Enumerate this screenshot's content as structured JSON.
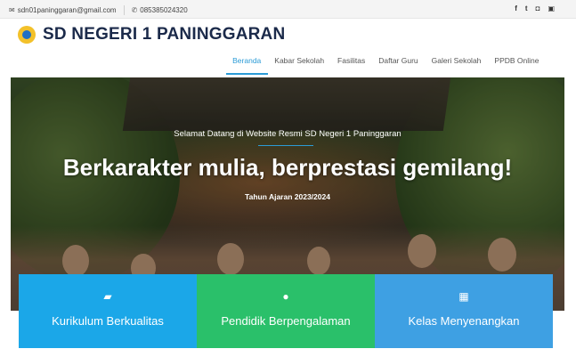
{
  "topbar": {
    "email_icon": "envelope-icon",
    "email": "sdn01paninggaran@gmail.com",
    "phone_icon": "phone-icon",
    "phone": "085385024320",
    "social": [
      {
        "icon": "facebook-icon",
        "glyph": "f"
      },
      {
        "icon": "twitter-icon",
        "glyph": "t"
      },
      {
        "icon": "instagram-icon",
        "glyph": "◘"
      },
      {
        "icon": "youtube-icon",
        "glyph": "▣"
      }
    ]
  },
  "header": {
    "logo_icon": "school-logo-icon",
    "title": "SD NEGERI 1 PANINGGARAN"
  },
  "nav": {
    "items": [
      {
        "label": "Beranda",
        "active": true
      },
      {
        "label": "Kabar Sekolah",
        "active": false
      },
      {
        "label": "Fasilitas",
        "active": false
      },
      {
        "label": "Daftar Guru",
        "active": false
      },
      {
        "label": "Galeri Sekolah",
        "active": false
      },
      {
        "label": "PPDB Online",
        "active": false
      }
    ],
    "accent": "#2b9bd6"
  },
  "hero": {
    "welcome": "Selamat Datang di Website Resmi SD Negeri 1 Paninggaran",
    "tagline": "Berkarakter mulia, berprestasi gemilang!",
    "year": "Tahun Ajaran 2023/2024"
  },
  "features": [
    {
      "icon": "book-icon",
      "glyph": "▰",
      "label": "Kurikulum Berkualitas",
      "color": "#1ba7e8"
    },
    {
      "icon": "users-icon",
      "glyph": "●",
      "label": "Pendidik Berpengalaman",
      "color": "#2ac06a"
    },
    {
      "icon": "table-icon",
      "glyph": "▦",
      "label": "Kelas Menyenangkan",
      "color": "#3ea0e3"
    }
  ]
}
